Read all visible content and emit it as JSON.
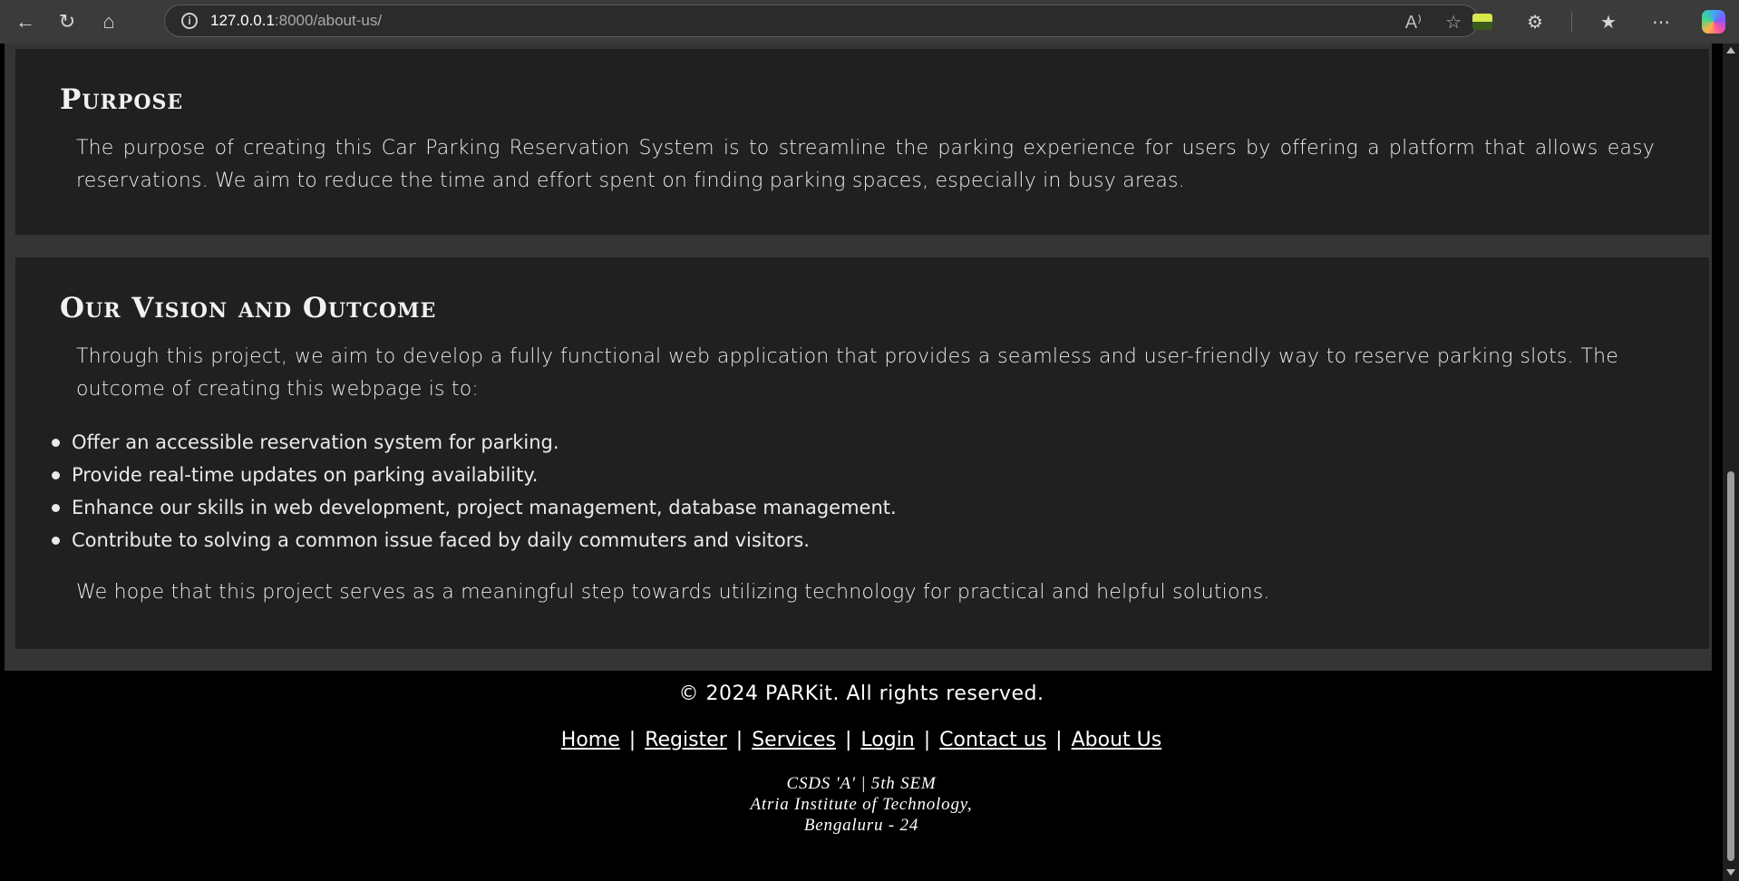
{
  "browser": {
    "url_host": "127.0.0.1",
    "url_rest": ":8000/about-us/",
    "back_icon": "arrow-left-icon",
    "refresh_icon": "refresh-icon",
    "home_icon": "home-icon"
  },
  "purpose": {
    "heading": "Purpose",
    "text": "The purpose of creating this Car Parking Reservation System is to streamline the parking experience for users by offering a platform that allows easy reservations. We aim to reduce the time and effort spent on finding parking spaces, especially in busy areas."
  },
  "vision": {
    "heading": "Our Vision and Outcome",
    "intro": "Through this project, we aim to develop a fully functional web application that provides a seamless and user-friendly way to reserve parking slots. The outcome of creating this webpage is to:",
    "items": [
      "Offer an accessible reservation system for parking.",
      "Provide real-time updates on parking availability.",
      "Enhance our skills in web development, project management, database management.",
      "Contribute to solving a common issue faced by daily commuters and visitors."
    ],
    "outro": "We hope that this project serves as a meaningful step towards utilizing technology for practical and helpful solutions."
  },
  "footer": {
    "copyright": "© 2024 PARKit. All rights reserved.",
    "links": [
      "Home",
      "Register",
      "Services",
      "Login",
      "Contact us",
      "About Us"
    ],
    "separator": "|",
    "line1": "CSDS 'A' | 5th SEM",
    "line2": "Atria Institute of Technology,",
    "line3": "Bengaluru - 24"
  }
}
